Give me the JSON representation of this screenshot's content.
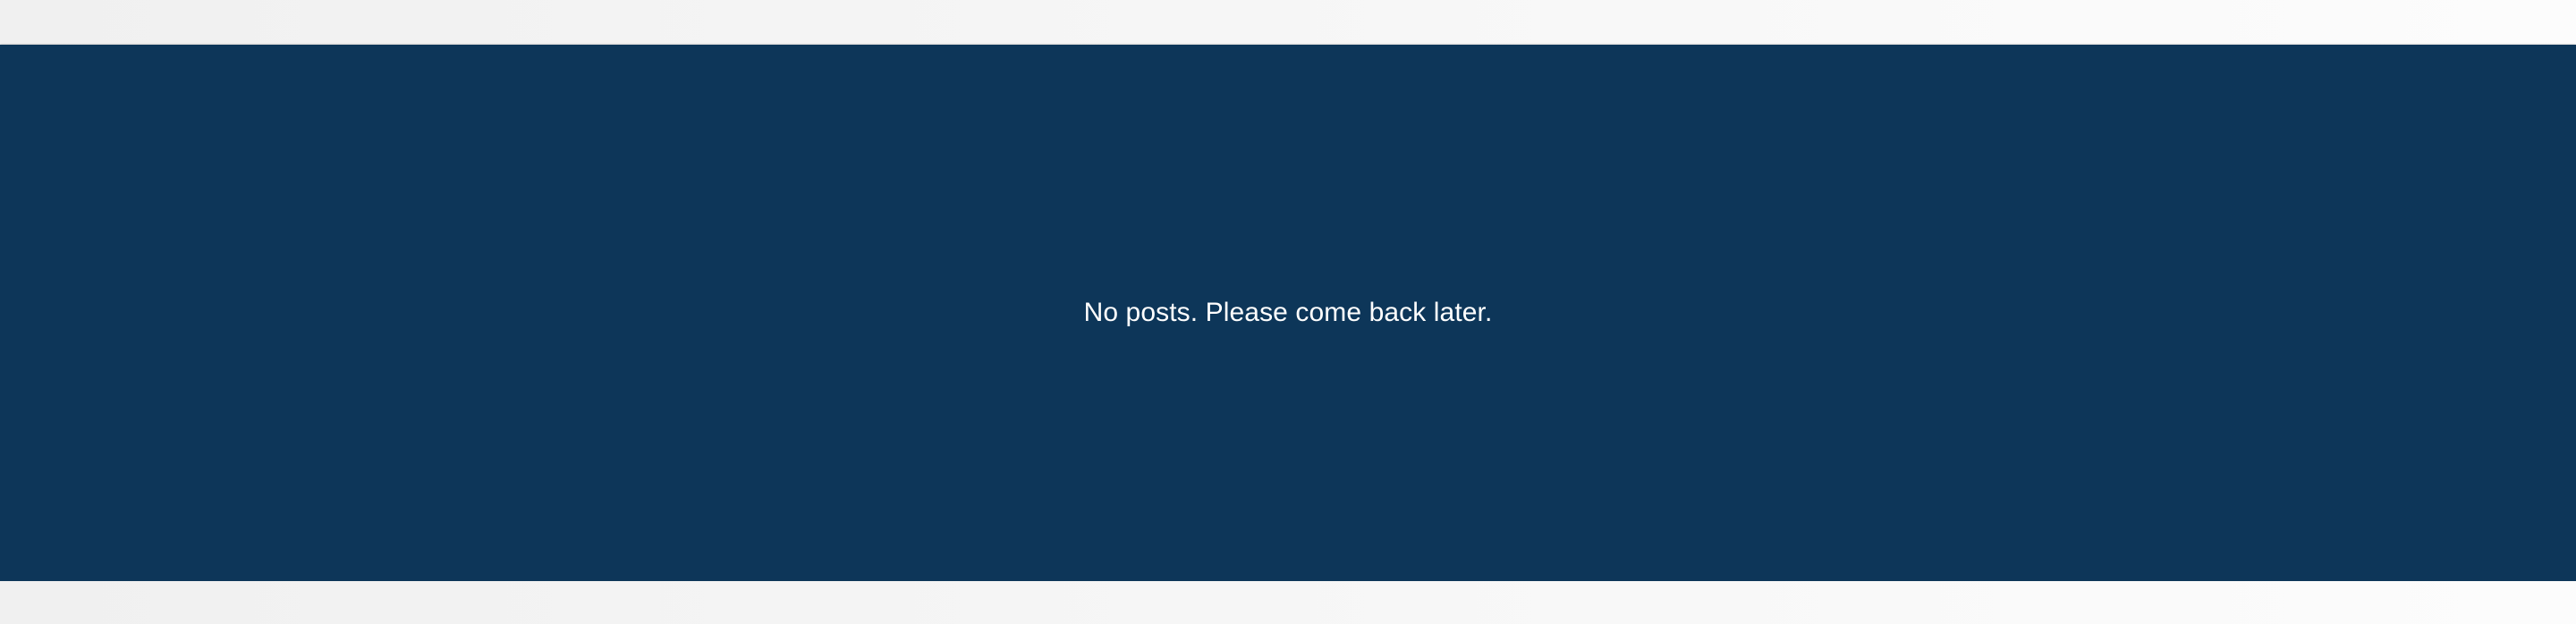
{
  "posts_panel": {
    "empty_message": "No posts. Please come back later.",
    "background_color": "#0d3659",
    "text_color": "#ffffff"
  }
}
